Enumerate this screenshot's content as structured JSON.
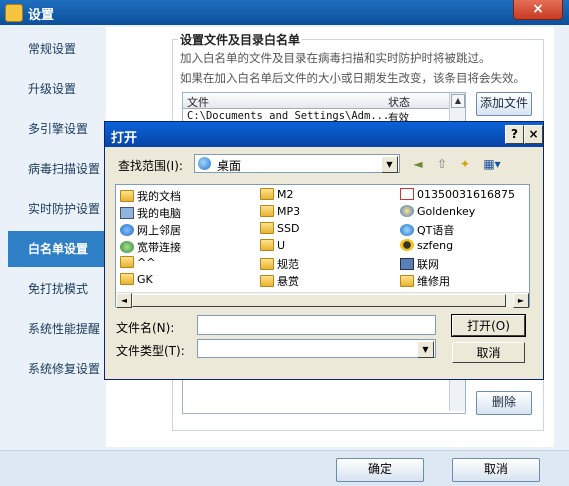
{
  "window": {
    "title": "设置",
    "close_label": "×"
  },
  "sidebar": {
    "items": [
      {
        "label": "常规设置"
      },
      {
        "label": "升级设置"
      },
      {
        "label": "多引擎设置"
      },
      {
        "label": "病毒扫描设置"
      },
      {
        "label": "实时防护设置"
      },
      {
        "label": "白名单设置",
        "active": true
      },
      {
        "label": "免打扰模式"
      },
      {
        "label": "系统性能提醒"
      },
      {
        "label": "系统修复设置"
      }
    ]
  },
  "whitelist": {
    "group_title": "设置文件及目录白名单",
    "desc_line1": "加入白名单的文件及目录在病毒扫描和实时防护时将被跳过。",
    "desc_line2": "如果在加入白名单后文件的大小或日期发生改变，该条目将会失效。",
    "columns": [
      "文件",
      "状态"
    ],
    "rows": [
      {
        "file": "C:\\Documents and Settings\\Adm...",
        "status": "有效"
      }
    ],
    "add_file_button": "添加文件",
    "delete_button": "删除"
  },
  "footer": {
    "ok_button": "确定",
    "cancel_button": "取消"
  },
  "open_dialog": {
    "title": "打开",
    "help_button": "?",
    "close_button": "×",
    "look_in_label": "查找范围(I):",
    "look_in_value": "桌面",
    "files": {
      "col1": [
        {
          "name": "我的文档",
          "icon": "my-documents-icon"
        },
        {
          "name": "我的电脑",
          "icon": "my-computer-icon"
        },
        {
          "name": "网上邻居",
          "icon": "network-places-icon"
        },
        {
          "name": "宽带连接",
          "icon": "broadband-connection-icon"
        },
        {
          "name": "^^",
          "icon": "folder-icon"
        },
        {
          "name": "GK",
          "icon": "folder-icon"
        }
      ],
      "col2": [
        {
          "name": "M2",
          "icon": "folder-icon"
        },
        {
          "name": "MP3",
          "icon": "folder-icon"
        },
        {
          "name": "SSD",
          "icon": "folder-icon"
        },
        {
          "name": "U",
          "icon": "folder-icon"
        },
        {
          "name": "规范",
          "icon": "folder-icon"
        },
        {
          "name": "悬赏",
          "icon": "folder-icon"
        }
      ],
      "col3": [
        {
          "name": "01350031616875",
          "icon": "pdf-file-icon"
        },
        {
          "name": "Goldenkey",
          "icon": "app-shortcut-icon"
        },
        {
          "name": "QT语音",
          "icon": "app-shortcut-icon"
        },
        {
          "name": "szfeng",
          "icon": "qq-icon"
        },
        {
          "name": "联网",
          "icon": "network-shortcut-icon"
        },
        {
          "name": "维修用",
          "icon": "folder-shortcut-icon"
        }
      ]
    },
    "file_name_label": "文件名(N):",
    "file_name_value": "",
    "file_type_label": "文件类型(T):",
    "file_type_value": "",
    "open_button": "打开(O)",
    "cancel_button": "取消"
  }
}
